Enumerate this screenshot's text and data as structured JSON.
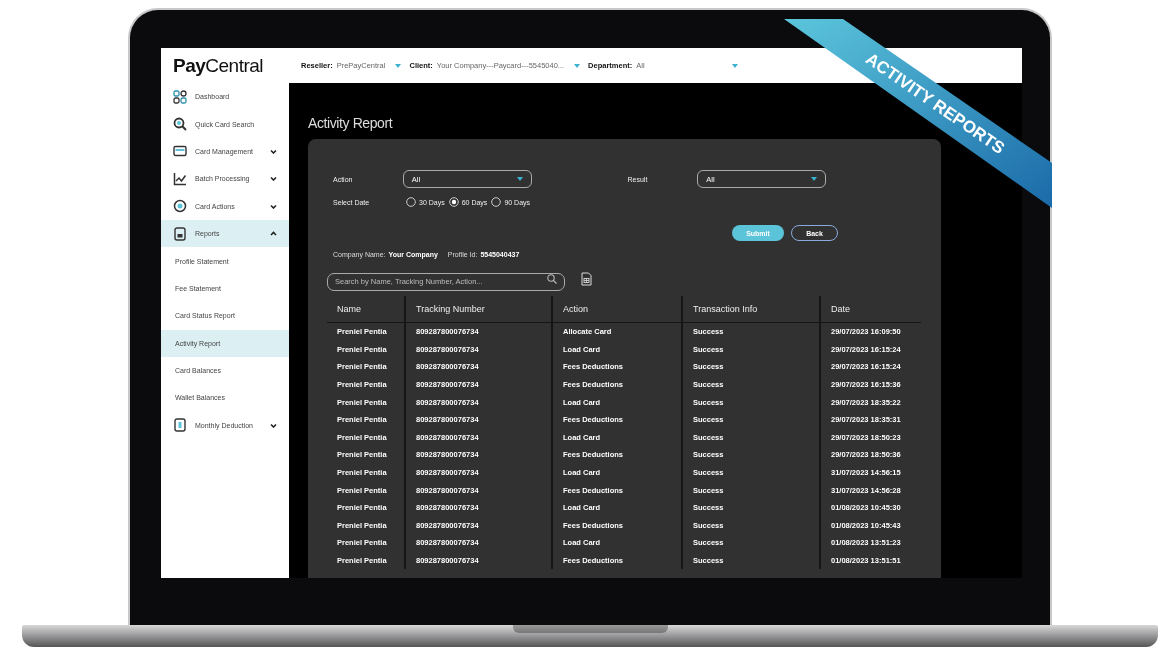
{
  "banner": {
    "text": "ACTIVITY REPORTS"
  },
  "app": {
    "logo": "**Pay**Central"
  },
  "header": {
    "filters": [
      {
        "label": "Reseller:",
        "value": "PrePayCentral"
      },
      {
        "label": "Client:",
        "value": "Your Company---Paycard---5545040..."
      },
      {
        "label": "Department:",
        "value": "All"
      }
    ]
  },
  "sidebar": {
    "items": [
      {
        "label": "Dashboard",
        "kind": "dashboard",
        "selected": false
      },
      {
        "label": "Quick Card Search",
        "kind": "search",
        "selected": false
      },
      {
        "label": "Card Management",
        "kind": "card",
        "selected": false,
        "expanded": false
      },
      {
        "label": "Batch Processing",
        "kind": "chart",
        "selected": false,
        "expanded": false
      },
      {
        "label": "Card Actions",
        "kind": "actions",
        "selected": false,
        "expanded": false
      },
      {
        "label": "Reports",
        "kind": "report",
        "selected": true,
        "expanded": true,
        "children": [
          {
            "label": "Profile Statement",
            "selected": false
          },
          {
            "label": "Fee Statement",
            "selected": false
          },
          {
            "label": "Card Status Report",
            "selected": false
          },
          {
            "label": "Activity Report",
            "selected": true
          },
          {
            "label": "Card Balances",
            "selected": false
          },
          {
            "label": "Wallet Balances",
            "selected": false
          }
        ]
      },
      {
        "label": "Monthly Deduction",
        "kind": "document",
        "selected": false,
        "expanded": false
      }
    ]
  },
  "page": {
    "title": "Activity Report"
  },
  "form": {
    "action": {
      "label": "Action",
      "value": "All"
    },
    "result": {
      "label": "Result",
      "value": "All"
    },
    "date": {
      "label": "Select Date",
      "options": [
        {
          "label": "30 Days",
          "selected": false
        },
        {
          "label": "60 Days",
          "selected": true
        },
        {
          "label": "90 Days",
          "selected": false
        }
      ]
    },
    "buttons": [
      {
        "label": "Submit",
        "kind": "primary"
      },
      {
        "label": "Back",
        "kind": "secondary"
      }
    ]
  },
  "profile": {
    "company_label": "Company Name:",
    "company": "Your Company",
    "id_label": "Profile Id:",
    "id": "5545040437"
  },
  "search": {
    "placeholder": "Search by Name, Tracking Number, Action..."
  },
  "table": {
    "columns": [
      "Name",
      "Tracking Number",
      "Action",
      "Transaction Info",
      "Date"
    ],
    "rows": [
      [
        "Preniel Pentia",
        "809287800076734",
        "Allocate Card",
        "Success",
        "29/07/2023 16:09:50"
      ],
      [
        "Preniel Pentia",
        "809287800076734",
        "Load Card",
        "Success",
        "29/07/2023 16:15:24"
      ],
      [
        "Preniel Pentia",
        "809287800076734",
        "Fees Deductions",
        "Success",
        "29/07/2023 16:15:24"
      ],
      [
        "Preniel Pentia",
        "809287800076734",
        "Fees Deductions",
        "Success",
        "29/07/2023 16:15:36"
      ],
      [
        "Preniel Pentia",
        "809287800076734",
        "Load Card",
        "Success",
        "29/07/2023 18:35:22"
      ],
      [
        "Preniel Pentia",
        "809287800076734",
        "Fees Deductions",
        "Success",
        "29/07/2023 18:35:31"
      ],
      [
        "Preniel Pentia",
        "809287800076734",
        "Load Card",
        "Success",
        "29/07/2023 18:50:23"
      ],
      [
        "Preniel Pentia",
        "809287800076734",
        "Fees Deductions",
        "Success",
        "29/07/2023 18:50:36"
      ],
      [
        "Preniel Pentia",
        "809287800076734",
        "Load Card",
        "Success",
        "31/07/2023 14:56:15"
      ],
      [
        "Preniel Pentia",
        "809287800076734",
        "Fees Deductions",
        "Success",
        "31/07/2023 14:56:28"
      ],
      [
        "Preniel Pentia",
        "809287800076734",
        "Load Card",
        "Success",
        "01/08/2023 10:45:30"
      ],
      [
        "Preniel Pentia",
        "809287800076734",
        "Fees Deductions",
        "Success",
        "01/08/2023 10:45:43"
      ],
      [
        "Preniel Pentia",
        "809287800076734",
        "Load Card",
        "Success",
        "01/08/2023 13:51:23"
      ],
      [
        "Preniel Pentia",
        "809287800076734",
        "Fees Deductions",
        "Success",
        "01/08/2023 13:51:51"
      ]
    ]
  }
}
